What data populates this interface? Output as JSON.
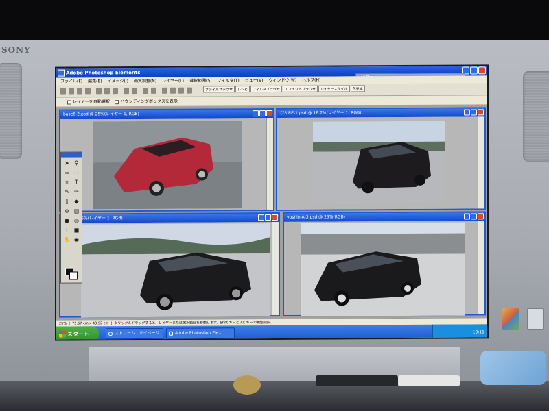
{
  "device": {
    "brand": "SONY"
  },
  "app": {
    "title": "Adobe Photoshop Elements",
    "menus": [
      "ファイル(F)",
      "編集(E)",
      "イメージ(I)",
      "画質調整(N)",
      "レイヤー(L)",
      "選択範囲(S)",
      "フィルタ(T)",
      "ビュー(V)",
      "ウィンドウ(W)",
      "ヘルプ(H)"
    ],
    "palette_tabs": [
      "ファイルブラウザ",
      "レシピ",
      "フィルタブラウザ",
      "エフェクトブラウザ",
      "レイヤースタイル",
      "色見本"
    ],
    "palette_title": "レイヤー",
    "options": {
      "auto_select_layer": "レイヤーを自動選択",
      "show_bounding_box": "バウンディングボックスを表示"
    }
  },
  "documents": [
    {
      "title": "base6-2.psd @ 25%(レイヤー 1, RGB)",
      "car_color": "#b3293a"
    },
    {
      "title": "びんRE-1.psd @ 16.7%(レイヤー 1, RGB)",
      "car_color": "#1d1b1e"
    },
    {
      "title": ".psd @ 25%(レイヤー 1, RGB)",
      "car_color": "#1b1a1d"
    },
    {
      "title": "yoshin-A-3.psd @ 25%(RGB)",
      "car_color": "#1a191c"
    }
  ],
  "status": {
    "zoom": "25%",
    "dimensions": "72.67 cm x 43.92 cm",
    "hint": "クリック＆ドラッグすると、レイヤーまたは選択範囲を移動します。Shift キーと Alt キーで機能拡張。"
  },
  "taskbar": {
    "start_label": "スタート",
    "items": [
      "ストリーム | マイページ...",
      "Adobe Photoshop Ele..."
    ],
    "clock": "19:11"
  },
  "colors": {
    "xp_blue": "#1c58cf",
    "start_green": "#2f8f2a",
    "laptop_silver": "#a7aab1"
  }
}
